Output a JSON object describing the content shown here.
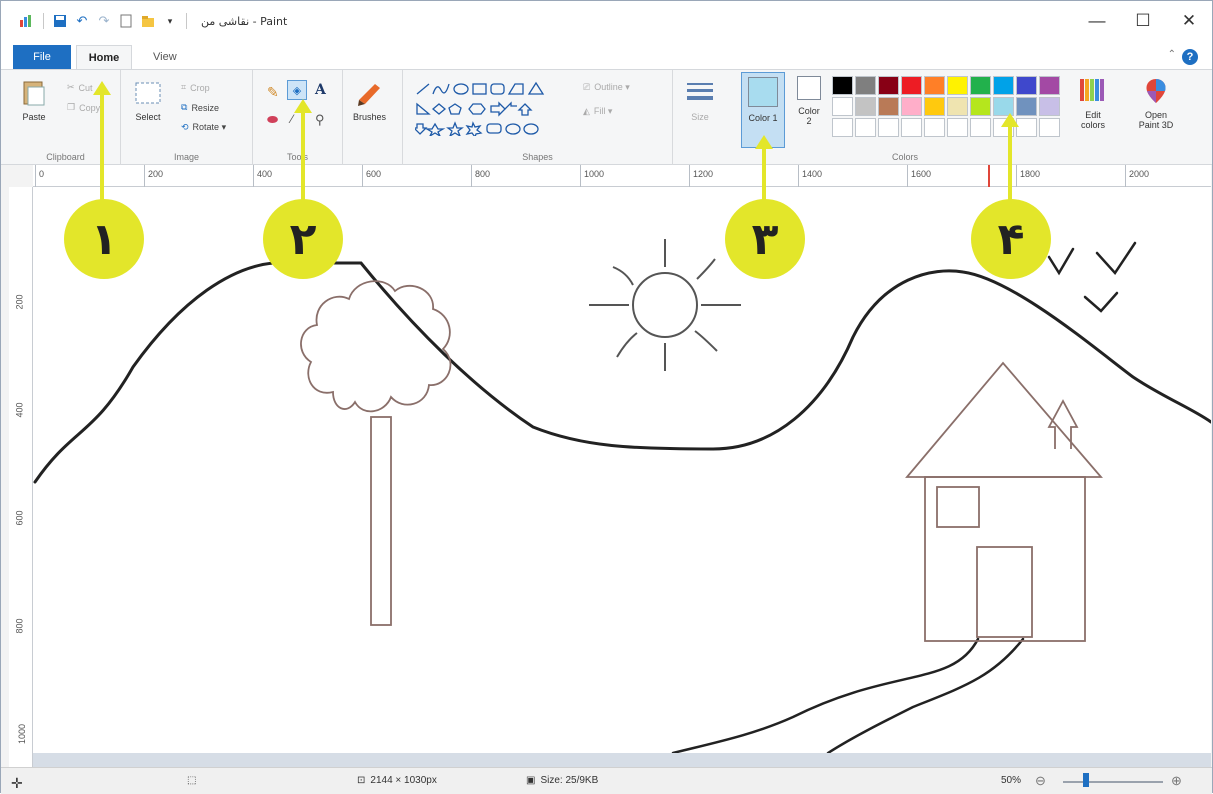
{
  "title": "نقاشی من - Paint",
  "tabs": {
    "file": "File",
    "home": "Home",
    "view": "View"
  },
  "clipboard": {
    "paste": "Paste",
    "cut": "Cut",
    "copy": "Copy",
    "label": "Clipboard"
  },
  "image": {
    "select": "Select",
    "crop": "Crop",
    "resize": "Resize",
    "rotate": "Rotate ▾",
    "label": "Image"
  },
  "tools": {
    "label": "Tools",
    "text_glyph": "A"
  },
  "brushes": {
    "label": "Brushes"
  },
  "shapes": {
    "outline": "Outline ▾",
    "fill": "Fill ▾",
    "label": "Shapes"
  },
  "size": {
    "label": "Size"
  },
  "colors": {
    "color1": "Color 1",
    "color2_line1": "Color",
    "color2_line2": "2",
    "edit_line1": "Edit",
    "edit_line2": "colors",
    "paint3d_line1": "Open",
    "paint3d_line2": "Paint 3D",
    "label": "Colors",
    "color1_value": "#a8dcef",
    "color2_value": "#ffffff",
    "palette": [
      "#000000",
      "#7f7f7f",
      "#880015",
      "#ed1c24",
      "#ff7f27",
      "#fff200",
      "#22b14c",
      "#00a2e8",
      "#3f48cc",
      "#a349a4",
      "#ffffff",
      "#c3c3c3",
      "#b97a57",
      "#ffaec9",
      "#ffc90e",
      "#efe4b0",
      "#b5e61d",
      "#99d9ea",
      "#7092be",
      "#c8bfe7",
      "#ffffff",
      "#ffffff",
      "#ffffff",
      "#ffffff",
      "#ffffff",
      "#ffffff",
      "#ffffff",
      "#ffffff",
      "#ffffff",
      "#ffffff"
    ]
  },
  "ruler": {
    "top": [
      "0",
      "200",
      "400",
      "600",
      "800",
      "1000",
      "1200",
      "1400",
      "1600",
      "1800",
      "2000"
    ],
    "left": [
      "200",
      "400",
      "600",
      "800",
      "1000"
    ]
  },
  "status": {
    "dimensions": "2144 × 1030px",
    "size": "Size: 25/9KB",
    "zoom": "50%"
  },
  "callouts": [
    "١",
    "٢",
    "٣",
    "۴"
  ]
}
